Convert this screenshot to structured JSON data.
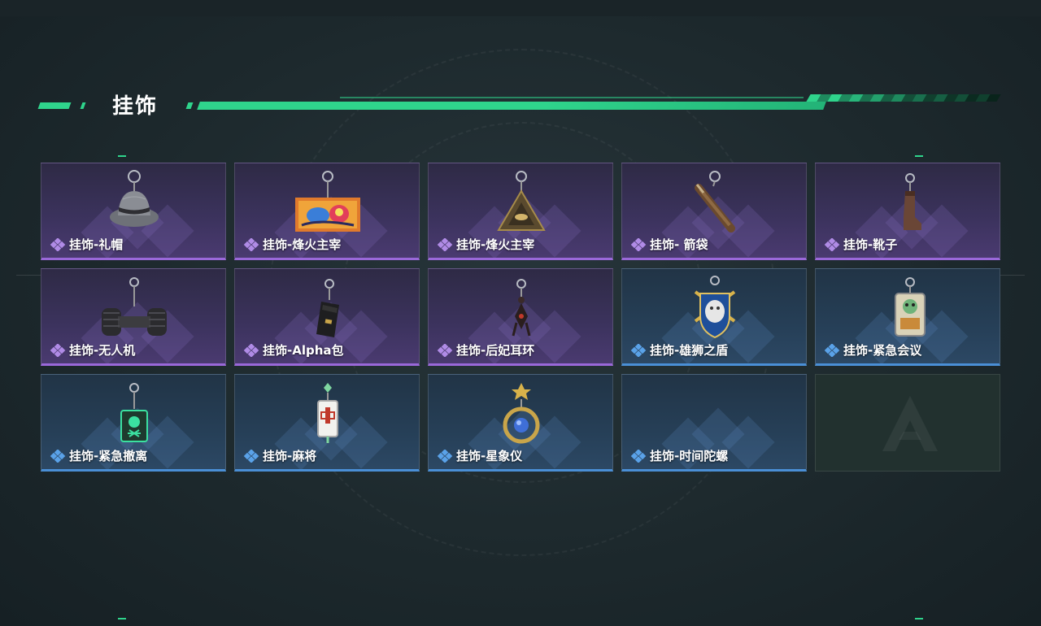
{
  "section": {
    "title": "挂饰"
  },
  "colors": {
    "accent": "#2fd48c",
    "purple_rarity": "#9a68d9",
    "blue_rarity": "#4a8fd6",
    "background": "#1d292d"
  },
  "items": [
    {
      "name": "挂饰-礼帽",
      "rarity": "purple",
      "icon": "fedora-hat-charm"
    },
    {
      "name": "挂饰-烽火主宰",
      "rarity": "purple",
      "icon": "graffiti-tag-charm"
    },
    {
      "name": "挂饰-烽火主宰",
      "rarity": "purple",
      "icon": "triangle-eye-charm"
    },
    {
      "name": "挂饰- 箭袋",
      "rarity": "purple",
      "icon": "quiver-charm"
    },
    {
      "name": "挂饰-靴子",
      "rarity": "purple",
      "icon": "boot-charm"
    },
    {
      "name": "挂饰-无人机",
      "rarity": "purple",
      "icon": "drone-charm"
    },
    {
      "name": "挂饰-Alpha包",
      "rarity": "purple",
      "icon": "alpha-bag-charm"
    },
    {
      "name": "挂饰-后妃耳环",
      "rarity": "purple",
      "icon": "earring-charm"
    },
    {
      "name": "挂饰-雄狮之盾",
      "rarity": "blue",
      "icon": "lion-shield-charm"
    },
    {
      "name": "挂饰-紧急会议",
      "rarity": "blue",
      "icon": "emergency-meeting-charm"
    },
    {
      "name": "挂饰-紧急撤离",
      "rarity": "blue",
      "icon": "emergency-evac-charm"
    },
    {
      "name": "挂饰-麻将",
      "rarity": "blue",
      "icon": "mahjong-tile-charm"
    },
    {
      "name": "挂饰-星象仪",
      "rarity": "blue",
      "icon": "astrolabe-charm"
    },
    {
      "name": "挂饰-时间陀螺",
      "rarity": "blue",
      "icon": "spinning-top-charm"
    },
    {
      "name": "",
      "rarity": "empty",
      "icon": "game-logo"
    }
  ]
}
